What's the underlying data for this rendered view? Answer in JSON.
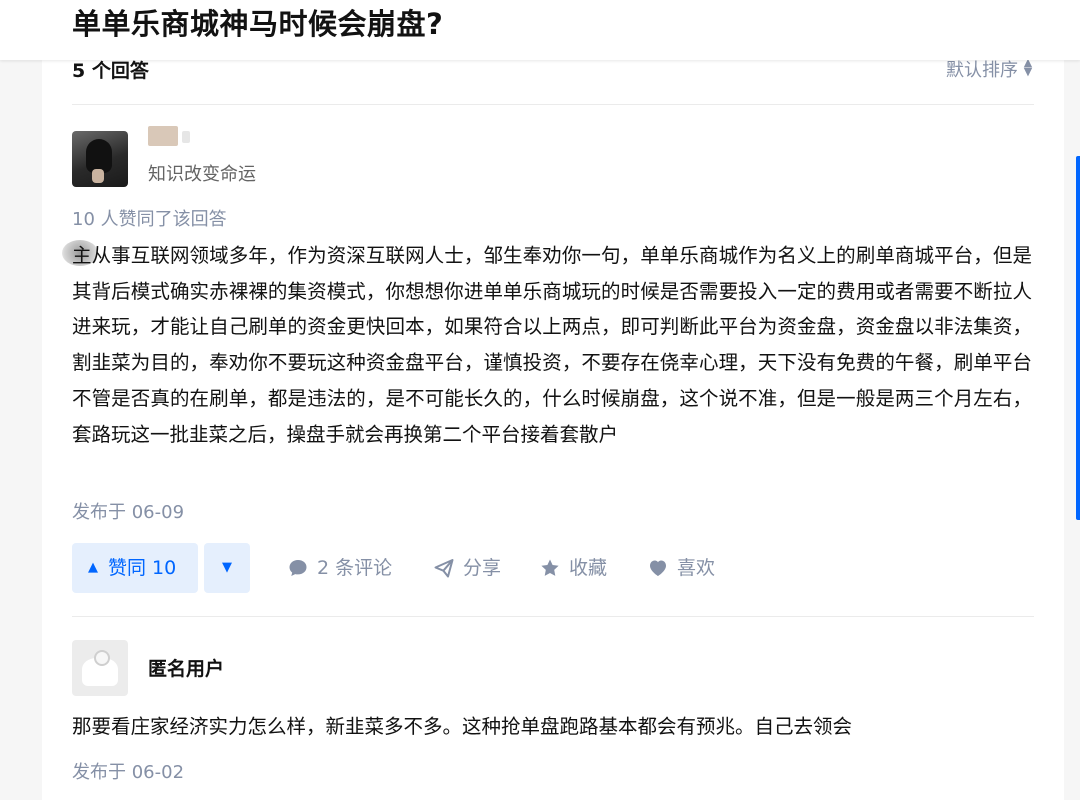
{
  "question": {
    "title": "单单乐商城神马时候会崩盘?"
  },
  "list_header": {
    "answer_count": "5 个回答",
    "sort_label": "默认排序",
    "sort_icon": "sort-updown-icon"
  },
  "answer1": {
    "author_headline": "知识改变命运",
    "voters_text": "10 人赞同了该回答",
    "content": "主从事互联网领域多年，作为资深互联网人士，邹生奉劝你一句，单单乐商城作为名义上的刷单商城平台，但是其背后模式确实赤裸裸的集资模式，你想想你进单单乐商城玩的时候是否需要投入一定的费用或者需要不断拉人进来玩，才能让自己刷单的资金更快回本，如果符合以上两点，即可判断此平台为资金盘，资金盘以非法集资，割韭菜为目的，奉劝你不要玩这种资金盘平台，谨慎投资，不要存在侥幸心理，天下没有免费的午餐，刷单平台不管是否真的在刷单，都是违法的，是不可能长久的，什么时候崩盘，这个说不准，但是一般是两三个月左右，套路玩这一批韭菜之后，操盘手就会再换第二个平台接着套散户",
    "published": "发布于 06-09",
    "actions": {
      "vote_up_label": "赞同 10",
      "comment_label": "2 条评论",
      "share_label": "分享",
      "collect_label": "收藏",
      "like_label": "喜欢"
    }
  },
  "answer2": {
    "author_name": "匿名用户",
    "content": "那要看庄家经济实力怎么样，新韭菜多不多。这种抢单盘跑路基本都会有预兆。自己去领会",
    "published": "发布于 06-02"
  },
  "colors": {
    "accent": "#0066ff",
    "vote_bg": "#e5effd",
    "meta_gray": "#8590a6"
  }
}
